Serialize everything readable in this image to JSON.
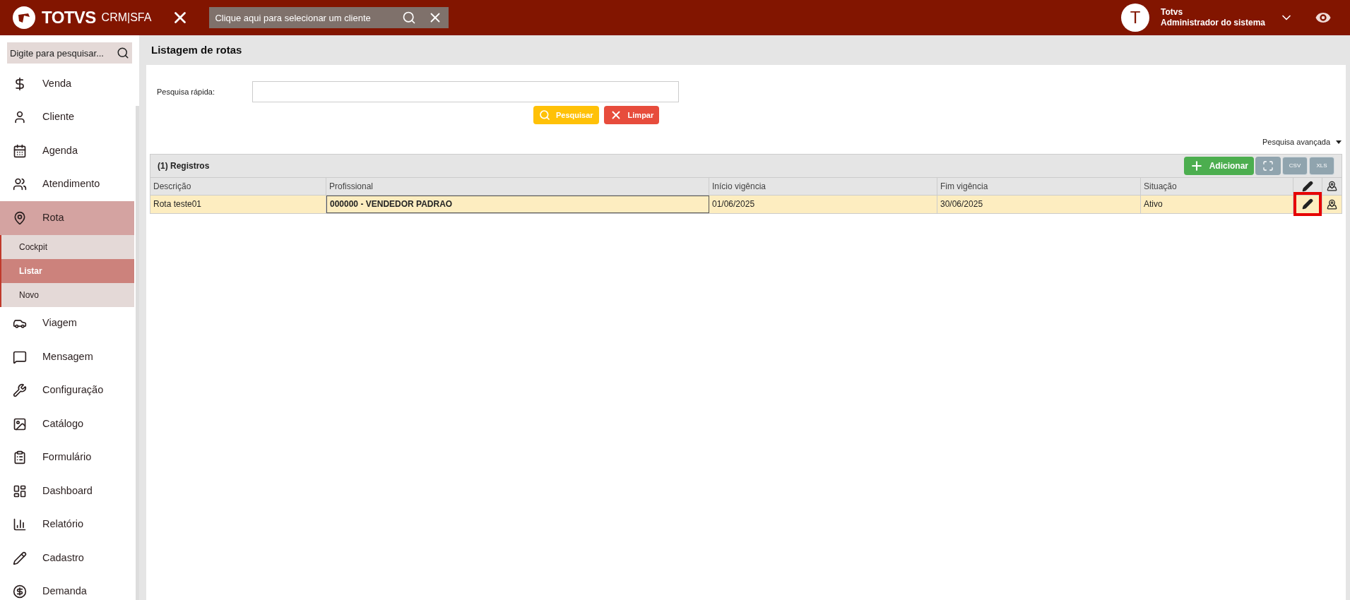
{
  "header": {
    "brand": "TOTVS",
    "product": "CRM|SFA",
    "client_search": {
      "placeholder": "Clique aqui para selecionar um cliente"
    },
    "user": {
      "initial": "T",
      "name": "Totvs",
      "role": "Administrador do sistema"
    }
  },
  "sidebar": {
    "search": {
      "placeholder": "Digite para pesquisar..."
    },
    "items": [
      {
        "label": "Venda",
        "expanded": false
      },
      {
        "label": "Cliente",
        "expanded": false
      },
      {
        "label": "Agenda",
        "expanded": false
      },
      {
        "label": "Atendimento",
        "expanded": false
      },
      {
        "label": "Rota",
        "expanded": true,
        "children": [
          {
            "label": "Cockpit",
            "selected": false
          },
          {
            "label": "Listar",
            "selected": true
          },
          {
            "label": "Novo",
            "selected": false
          }
        ]
      },
      {
        "label": "Viagem",
        "expanded": false
      },
      {
        "label": "Mensagem",
        "expanded": false
      },
      {
        "label": "Configuração",
        "expanded": false
      },
      {
        "label": "Catálogo",
        "expanded": false
      },
      {
        "label": "Formulário",
        "expanded": false
      },
      {
        "label": "Dashboard",
        "expanded": false
      },
      {
        "label": "Relatório",
        "expanded": false
      },
      {
        "label": "Cadastro",
        "expanded": false
      },
      {
        "label": "Demanda",
        "expanded": false
      }
    ]
  },
  "page": {
    "title": "Listagem de rotas",
    "quick_search": {
      "label": "Pesquisa rápida:"
    },
    "search_button": "Pesquisar",
    "clear_button": "Limpar",
    "advanced_search": "Pesquisa avançada"
  },
  "table": {
    "count": "(1) Registros",
    "add_button": "Adicionar",
    "export_buttons": [
      "CSV",
      "XLS"
    ],
    "columns": [
      "Descrição",
      "Profissional",
      "Início vigência",
      "Fim vigência",
      "Situação"
    ],
    "rows": [
      {
        "selected": true,
        "cells": [
          {
            "text": "Rota teste01",
            "focused": false
          },
          {
            "text": "000000 - VENDEDOR PADRAO",
            "focused": true
          },
          {
            "text": "01/06/2025",
            "focused": false
          },
          {
            "text": "30/06/2025",
            "focused": false
          },
          {
            "text": "Ativo",
            "focused": false
          }
        ],
        "edit_highlighted": true
      }
    ]
  }
}
